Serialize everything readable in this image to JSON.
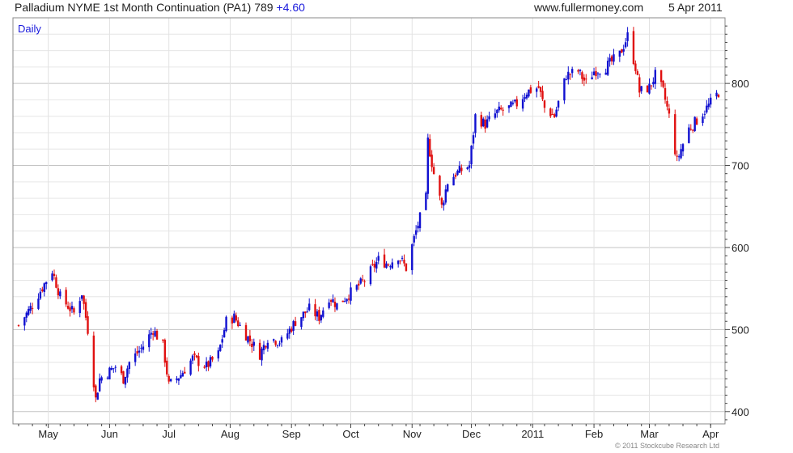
{
  "header": {
    "title": "Palladium NYME 1st Month Continuation (PA1) 789",
    "change": "+4.60",
    "site": "www.fullermoney.com",
    "date": "5 Apr 2011"
  },
  "footer": {
    "copyright": "© 2011 Stockcube Research Ltd"
  },
  "colors": {
    "up": "#1010d0",
    "down": "#e01010",
    "grid": "#d8d8d8",
    "axis": "#444444",
    "label": "#1a1adc"
  },
  "chart_data": {
    "type": "candlestick",
    "period_label": "Daily",
    "ylim": [
      385,
      880
    ],
    "y_ticks": [
      400,
      500,
      600,
      700,
      800
    ],
    "x_ticks": [
      "May",
      "Jun",
      "Jul",
      "Aug",
      "Sep",
      "Oct",
      "Nov",
      "Dec",
      "2011",
      "Feb",
      "Mar",
      "Apr"
    ],
    "x_range": [
      "2010-04-16",
      "2011-04-05"
    ],
    "last_close": 789,
    "approximate_closes": [
      [
        "2010-04-16",
        505
      ],
      [
        "2010-04-23",
        530
      ],
      [
        "2010-04-30",
        560
      ],
      [
        "2010-05-03",
        572
      ],
      [
        "2010-05-07",
        540
      ],
      [
        "2010-05-14",
        520
      ],
      [
        "2010-05-18",
        545
      ],
      [
        "2010-05-21",
        500
      ],
      [
        "2010-05-25",
        415
      ],
      [
        "2010-05-27",
        440
      ],
      [
        "2010-06-04",
        455
      ],
      [
        "2010-06-08",
        440
      ],
      [
        "2010-06-11",
        460
      ],
      [
        "2010-06-18",
        480
      ],
      [
        "2010-06-23",
        500
      ],
      [
        "2010-06-28",
        480
      ],
      [
        "2010-07-01",
        432
      ],
      [
        "2010-07-07",
        445
      ],
      [
        "2010-07-13",
        465
      ],
      [
        "2010-07-20",
        455
      ],
      [
        "2010-07-26",
        470
      ],
      [
        "2010-07-30",
        510
      ],
      [
        "2010-08-03",
        515
      ],
      [
        "2010-08-10",
        490
      ],
      [
        "2010-08-16",
        470
      ],
      [
        "2010-08-20",
        490
      ],
      [
        "2010-08-27",
        485
      ],
      [
        "2010-09-03",
        510
      ],
      [
        "2010-09-10",
        525
      ],
      [
        "2010-09-15",
        515
      ],
      [
        "2010-09-20",
        540
      ],
      [
        "2010-09-24",
        530
      ],
      [
        "2010-10-01",
        545
      ],
      [
        "2010-10-08",
        560
      ],
      [
        "2010-10-15",
        585
      ],
      [
        "2010-10-20",
        580
      ],
      [
        "2010-10-25",
        590
      ],
      [
        "2010-10-29",
        575
      ],
      [
        "2010-11-03",
        620
      ],
      [
        "2010-11-08",
        660
      ],
      [
        "2010-11-09",
        730
      ],
      [
        "2010-11-12",
        690
      ],
      [
        "2010-11-16",
        650
      ],
      [
        "2010-11-19",
        680
      ],
      [
        "2010-11-23",
        690
      ],
      [
        "2010-11-30",
        700
      ],
      [
        "2010-12-03",
        760
      ],
      [
        "2010-12-08",
        750
      ],
      [
        "2010-12-14",
        765
      ],
      [
        "2010-12-20",
        770
      ],
      [
        "2010-12-24",
        775
      ],
      [
        "2010-12-29",
        790
      ],
      [
        "2011-01-04",
        795
      ],
      [
        "2011-01-07",
        770
      ],
      [
        "2011-01-12",
        760
      ],
      [
        "2011-01-18",
        810
      ],
      [
        "2011-01-24",
        815
      ],
      [
        "2011-01-28",
        800
      ],
      [
        "2011-02-01",
        815
      ],
      [
        "2011-02-07",
        820
      ],
      [
        "2011-02-14",
        835
      ],
      [
        "2011-02-18",
        858
      ],
      [
        "2011-02-22",
        820
      ],
      [
        "2011-02-24",
        790
      ],
      [
        "2011-03-01",
        795
      ],
      [
        "2011-03-04",
        810
      ],
      [
        "2011-03-08",
        790
      ],
      [
        "2011-03-11",
        760
      ],
      [
        "2011-03-15",
        705
      ],
      [
        "2011-03-17",
        720
      ],
      [
        "2011-03-21",
        745
      ],
      [
        "2011-03-25",
        755
      ],
      [
        "2011-03-30",
        770
      ],
      [
        "2011-04-05",
        789
      ]
    ]
  }
}
